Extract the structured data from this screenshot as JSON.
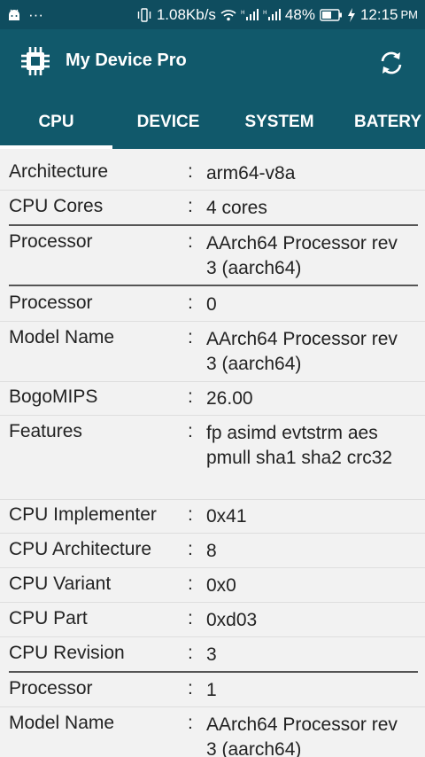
{
  "statusbar": {
    "speed": "1.08Kb/s",
    "battery": "48%",
    "time": "12:15",
    "ampm": "PM",
    "dots": "···"
  },
  "app": {
    "title": "My Device Pro"
  },
  "tabs": [
    "CPU",
    "DEVICE",
    "SYSTEM",
    "BATERY"
  ],
  "rows": [
    {
      "label": "Architecture",
      "value": "arm64-v8a"
    },
    {
      "label": "CPU Cores",
      "value": "4 cores"
    },
    {
      "label": "Processor",
      "value": "AArch64 Processor rev 3 (aarch64)"
    },
    {
      "label": "Processor",
      "value": "0"
    },
    {
      "label": "Model Name",
      "value": "AArch64 Processor rev 3 (aarch64)"
    },
    {
      "label": "BogoMIPS",
      "value": "26.00"
    },
    {
      "label": "Features",
      "value": "fp asimd evtstrm aes pmull sha1 sha2 crc32"
    },
    {
      "label": "CPU Implementer",
      "value": "0x41"
    },
    {
      "label": "CPU Architecture",
      "value": "8"
    },
    {
      "label": "CPU Variant",
      "value": "0x0"
    },
    {
      "label": "CPU Part",
      "value": "0xd03"
    },
    {
      "label": "CPU Revision",
      "value": "3"
    },
    {
      "label": "Processor",
      "value": "1"
    },
    {
      "label": "Model Name",
      "value": "AArch64 Processor rev 3 (aarch64)"
    }
  ],
  "colon": ":"
}
